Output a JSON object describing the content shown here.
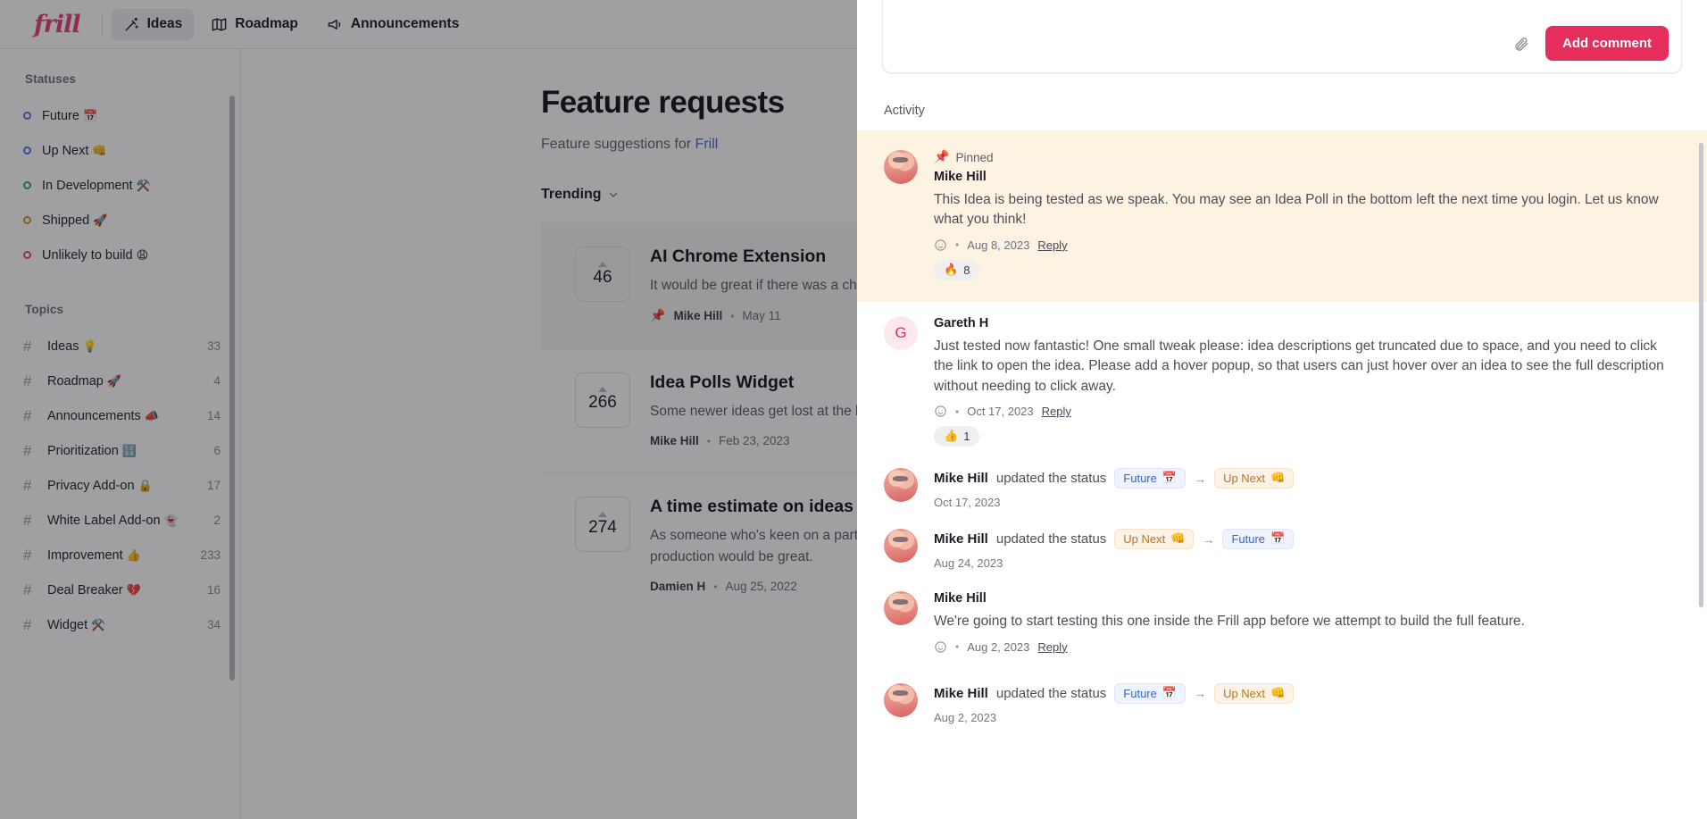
{
  "topnav": {
    "brand": "frill",
    "items": [
      {
        "label": "Ideas",
        "icon": "wand-icon",
        "active": true
      },
      {
        "label": "Roadmap",
        "icon": "map-icon",
        "active": false
      },
      {
        "label": "Announcements",
        "icon": "megaphone-icon",
        "active": false
      }
    ]
  },
  "sidebar": {
    "statuses_heading": "Statuses",
    "statuses": [
      {
        "label": "Future",
        "emoji": "📅",
        "color": "#4a7bdd"
      },
      {
        "label": "Up Next",
        "emoji": "👊",
        "color": "#4a7bdd"
      },
      {
        "label": "In Development",
        "emoji": "⚒️",
        "color": "#35a85b"
      },
      {
        "label": "Shipped",
        "emoji": "🚀",
        "color": "#e08a2c"
      },
      {
        "label": "Unlikely to build",
        "emoji": "😩",
        "color": "#e0457b"
      }
    ],
    "topics_heading": "Topics",
    "topics": [
      {
        "label": "Ideas",
        "emoji": "💡",
        "count": "33"
      },
      {
        "label": "Roadmap",
        "emoji": "🚀",
        "count": "4"
      },
      {
        "label": "Announcements",
        "emoji": "📣",
        "count": "14"
      },
      {
        "label": "Prioritization",
        "emoji": "🔢",
        "count": "6"
      },
      {
        "label": "Privacy Add-on",
        "emoji": "🔒",
        "count": "17"
      },
      {
        "label": "White Label Add-on",
        "emoji": "👻",
        "count": "2"
      },
      {
        "label": "Improvement",
        "emoji": "👍",
        "count": "233"
      },
      {
        "label": "Deal Breaker",
        "emoji": "💔",
        "count": "16"
      },
      {
        "label": "Widget",
        "emoji": "⚒️",
        "count": "34"
      }
    ]
  },
  "main": {
    "title": "Feature requests",
    "subtitle_prefix": "Feature suggestions for ",
    "subtitle_link": "Frill",
    "sort_label": "Trending",
    "ideas": [
      {
        "votes": "46",
        "title": "AI Chrome Extension",
        "desc": "It would be great if there was a chrome extension to capture feedback into one place.",
        "pinned": true,
        "author": "Mike Hill",
        "date": "May 11"
      },
      {
        "votes": "266",
        "title": "Idea Polls Widget",
        "desc": "Some newer ideas get lost at the bottom of the list. We would like to show them.",
        "pinned": false,
        "author": "Mike Hill",
        "date": "Feb 23, 2023"
      },
      {
        "votes": "274",
        "title": "A time estimate on ideas",
        "desc": "As someone who's keen on a particular idea, knowing how long before it makes it into production would be great.",
        "pinned": false,
        "author": "Damien H",
        "date": "Aug 25, 2022"
      }
    ]
  },
  "panel": {
    "compose": {
      "attach_icon": "paperclip-icon",
      "submit_label": "Add comment"
    },
    "activity_label": "Activity",
    "activity": [
      {
        "kind": "comment",
        "pinned": true,
        "pinned_label": "Pinned",
        "avatar_type": "photo",
        "name": "Mike Hill",
        "text": "This Idea is being tested as we speak. You may see an Idea Poll in the bottom left the next time you login. Let us know what you think!",
        "date": "Aug 8, 2023",
        "reply_label": "Reply",
        "reactions": [
          {
            "emoji": "🔥",
            "count": "8"
          }
        ]
      },
      {
        "kind": "comment",
        "pinned": false,
        "avatar_type": "letter",
        "avatar_letter": "G",
        "name": "Gareth H",
        "text": "Just tested now fantastic! One small tweak please: idea descriptions get truncated due to space, and you need to click the link to open the idea. Please add a hover popup, so that users can just hover over an idea to see the full description without needing to click away.",
        "date": "Oct 17, 2023",
        "reply_label": "Reply",
        "reactions": [
          {
            "emoji": "👍",
            "count": "1"
          }
        ]
      },
      {
        "kind": "status",
        "who": "Mike Hill",
        "action": "updated the status",
        "from": {
          "label": "Future",
          "emoji": "📅",
          "style": "future"
        },
        "to": {
          "label": "Up Next",
          "emoji": "👊",
          "style": "upnext"
        },
        "date": "Oct 17, 2023"
      },
      {
        "kind": "status",
        "who": "Mike Hill",
        "action": "updated the status",
        "from": {
          "label": "Up Next",
          "emoji": "👊",
          "style": "upnext"
        },
        "to": {
          "label": "Future",
          "emoji": "📅",
          "style": "future"
        },
        "date": "Aug 24, 2023"
      },
      {
        "kind": "comment",
        "pinned": false,
        "avatar_type": "photo",
        "name": "Mike Hill",
        "text": "We're going to start testing this one inside the Frill app before we attempt to build the full feature.",
        "date": "Aug 2, 2023",
        "reply_label": "Reply",
        "reactions": []
      },
      {
        "kind": "status",
        "who": "Mike Hill",
        "action": "updated the status",
        "from": {
          "label": "Future",
          "emoji": "📅",
          "style": "future"
        },
        "to": {
          "label": "Up Next",
          "emoji": "👊",
          "style": "upnext"
        },
        "date": "Aug 2, 2023"
      }
    ]
  },
  "colors": {
    "brand": "#e0457b",
    "primary_button": "#e62e5c",
    "pinned_bg": "#fdf3e3"
  }
}
